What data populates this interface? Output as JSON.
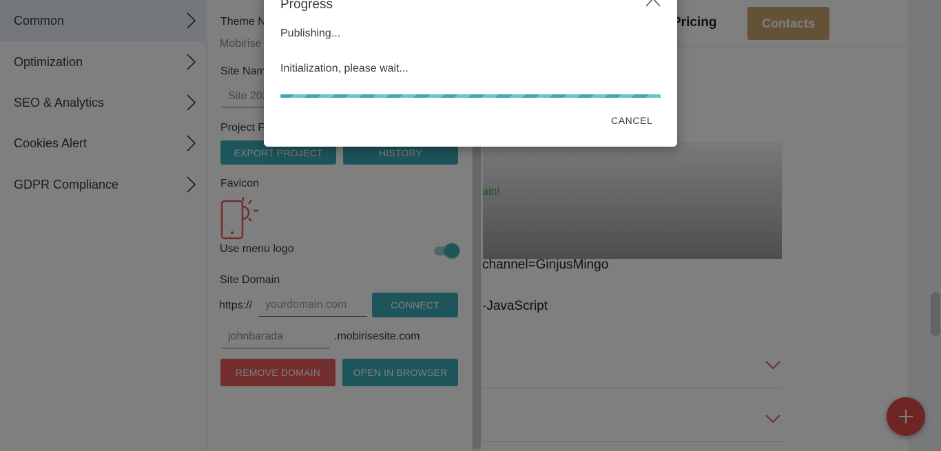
{
  "site": {
    "nav_pricing": "Pricing",
    "nav_contacts": "Contacts",
    "hero_text": "ain!",
    "line_1": "channel=GinjusMingo",
    "line_2": "-JavaScript"
  },
  "sidebar": {
    "items": [
      {
        "label": "Common",
        "active": true
      },
      {
        "label": "Optimization"
      },
      {
        "label": "SEO & Analytics"
      },
      {
        "label": "Cookies Alert"
      },
      {
        "label": "GDPR Compliance"
      }
    ]
  },
  "settings": {
    "theme_label": "Theme N",
    "theme_value": "Mobirise",
    "site_name_label": "Site Nam",
    "site_name_value": "Site 202",
    "project_files_label": "Project Fi",
    "export_button": "EXPORT PROJECT",
    "history_button": "HISTORY",
    "favicon_label": "Favicon",
    "use_menu_logo_label": "Use menu logo",
    "use_menu_logo_on": true,
    "site_domain_label": "Site Domain",
    "https_prefix": "https://",
    "domain_placeholder": "yourdomain.com",
    "connect_button": "CONNECT",
    "subdomain_value": "johnbarada",
    "subdomain_suffix": ".mobirisesite.com",
    "remove_domain_button": "REMOVE DOMAIN",
    "open_browser_button": "OPEN IN BROWSER"
  },
  "dialog": {
    "title": "Progress",
    "status": "Publishing...",
    "message": "Initialization, please wait...",
    "cancel": "CANCEL"
  },
  "colors": {
    "accent_teal": "#3aaab6",
    "danger_red": "#e45a5e",
    "brand_gold": "#c9a46d",
    "fab_red": "#e14a4a"
  }
}
